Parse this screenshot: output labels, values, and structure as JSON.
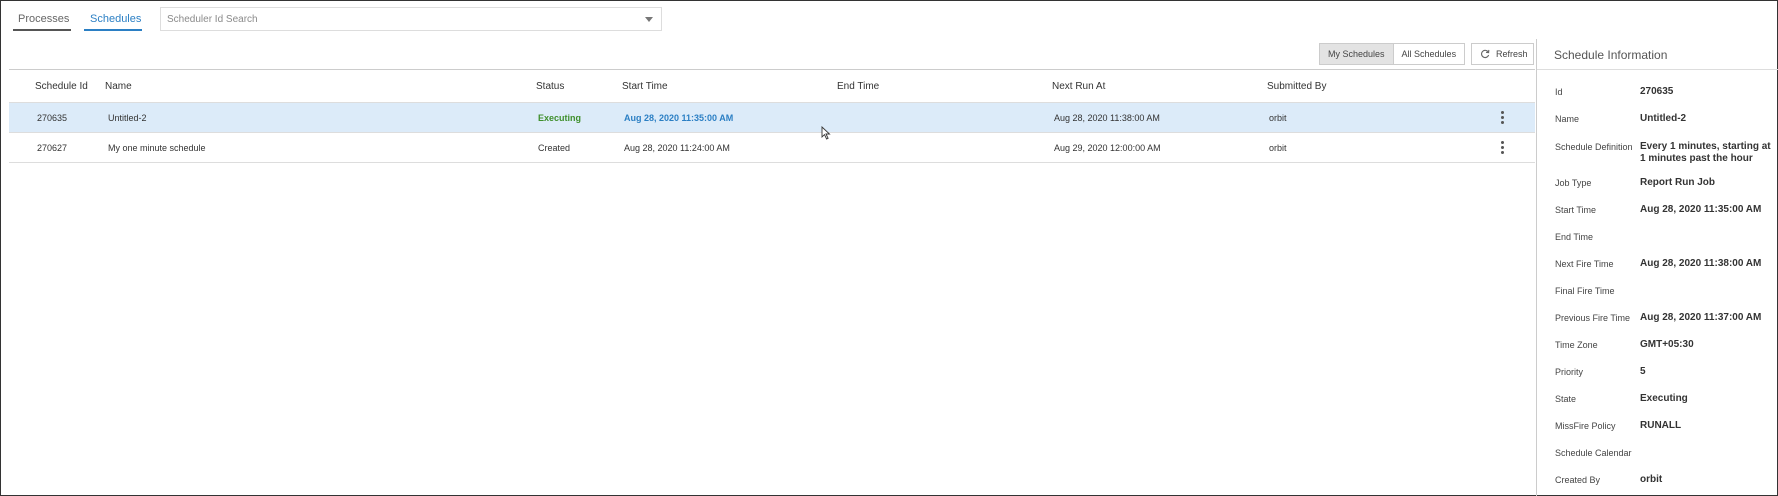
{
  "tabs": [
    {
      "label": "Processes"
    },
    {
      "label": "Schedules"
    }
  ],
  "search": {
    "placeholder": "Scheduler Id Search",
    "value": ""
  },
  "toolbar": {
    "my_schedules": "My Schedules",
    "all_schedules": "All Schedules",
    "active_filter": "My Schedules",
    "refresh": "Refresh"
  },
  "table": {
    "columns": [
      "Schedule Id",
      "Name",
      "Status",
      "Start Time",
      "End Time",
      "Next Run At",
      "Submitted By"
    ],
    "rows": [
      {
        "id": "270635",
        "name": "Untitled-2",
        "status": "Executing",
        "start": "Aug 28, 2020 11:35:00 AM",
        "end": "",
        "next": "Aug 28, 2020 11:38:00 AM",
        "by": "orbit",
        "selected": true
      },
      {
        "id": "270627",
        "name": "My one minute schedule",
        "status": "Created",
        "start": "Aug 28, 2020 11:24:00 AM",
        "end": "",
        "next": "Aug 29, 2020 12:00:00 AM",
        "by": "orbit",
        "selected": false
      }
    ]
  },
  "details": {
    "title": "Schedule Information",
    "fields": [
      {
        "label": "Id",
        "value": "270635"
      },
      {
        "label": "Name",
        "value": "Untitled-2"
      },
      {
        "label": "Schedule Definition",
        "value": "Every 1 minutes, starting at 1 minutes past the hour"
      },
      {
        "label": "Job Type",
        "value": "Report Run Job"
      },
      {
        "label": "Start Time",
        "value": "Aug 28, 2020 11:35:00 AM"
      },
      {
        "label": "End Time",
        "value": ""
      },
      {
        "label": "Next Fire Time",
        "value": "Aug 28, 2020 11:38:00 AM"
      },
      {
        "label": "Final Fire Time",
        "value": ""
      },
      {
        "label": "Previous Fire Time",
        "value": "Aug 28, 2020 11:37:00 AM"
      },
      {
        "label": "Time Zone",
        "value": "GMT+05:30"
      },
      {
        "label": "Priority",
        "value": "5"
      },
      {
        "label": "State",
        "value": "Executing"
      },
      {
        "label": "MissFire Policy",
        "value": "RUNALL"
      },
      {
        "label": "Schedule Calendar",
        "value": ""
      },
      {
        "label": "Created By",
        "value": "orbit"
      }
    ]
  },
  "colors": {
    "accent": "#2b7fc4",
    "selected_row": "#dcebf9",
    "status_executing": "#3f8f2c"
  },
  "icons": {
    "refresh": "refresh-icon",
    "dropdown": "chevron-down-icon",
    "row_menu": "more-vertical-icon",
    "cursor": "mouse-pointer-icon"
  }
}
